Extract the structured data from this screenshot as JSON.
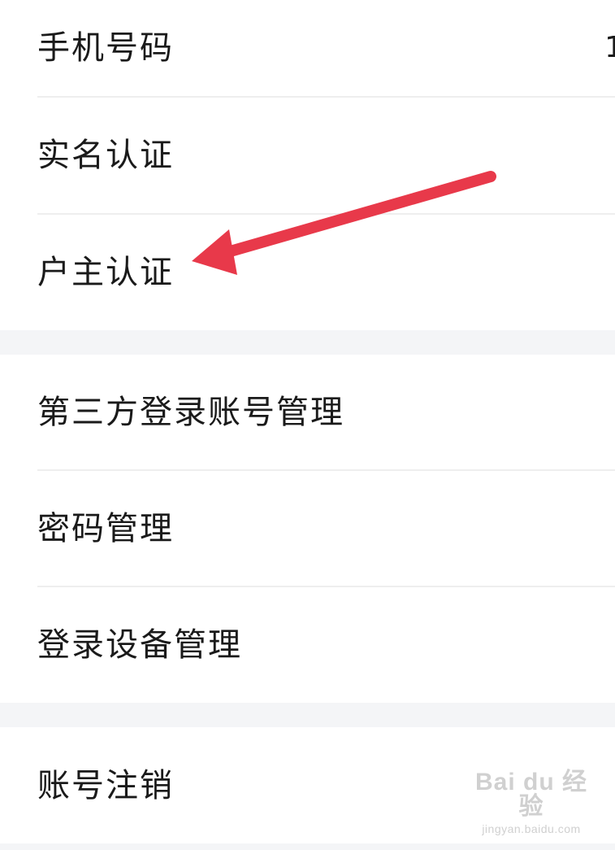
{
  "account_section": {
    "items": [
      {
        "label": "手机号码",
        "value": "1"
      },
      {
        "label": "实名认证"
      },
      {
        "label": "户主认证"
      }
    ]
  },
  "security_section": {
    "items": [
      {
        "label": "第三方登录账号管理"
      },
      {
        "label": "密码管理"
      },
      {
        "label": "登录设备管理"
      }
    ]
  },
  "danger_section": {
    "items": [
      {
        "label": "账号注销"
      }
    ]
  },
  "annotation": {
    "arrow_color": "#e8394a",
    "points_to": "户主认证"
  },
  "watermark": {
    "logo": "Bai du 经验",
    "url": "jingyan.baidu.com"
  },
  "colors": {
    "page_background": "#f4f5f7",
    "card_background": "#ffffff",
    "divider": "#eeeeee",
    "text": "#1a1a1a"
  }
}
